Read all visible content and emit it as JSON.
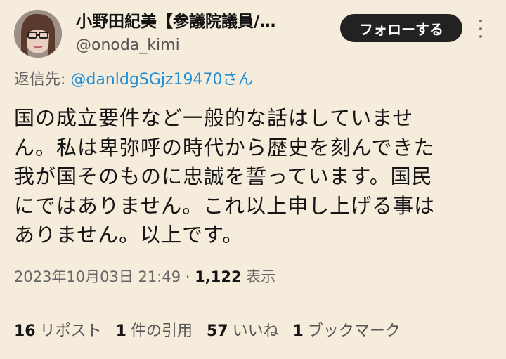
{
  "author": {
    "display_name": "小野田紀美【参議院議員/…",
    "handle": "@onoda_kimi"
  },
  "follow_button_label": "フォローする",
  "reply": {
    "prefix": "返信先: ",
    "target": "@danldgSGjz19470さん"
  },
  "tweet_text": "国の成立要件など一般的な話はしていませ\nん。私は卑弥呼の時代から歴史を刻んできた\n我が国そのものに忠誠を誓っています。国民\nにではありません。これ以上申し上げる事は\nありません。以上です。",
  "meta": {
    "timestamp": "2023年10月03日 21:49",
    "separator": " · ",
    "views_count": "1,122",
    "views_label": " 表示"
  },
  "stats": {
    "reposts": {
      "count": "16",
      "label": "リポスト"
    },
    "quotes": {
      "count": "1",
      "label": "件の引用"
    },
    "likes": {
      "count": "57",
      "label": "いいね"
    },
    "bookmarks": {
      "count": "1",
      "label": "ブックマーク"
    }
  },
  "colors": {
    "background": "#f6ecdc",
    "link": "#1d8ed6",
    "button": "#222222"
  },
  "icons": [
    "avatar",
    "more-options-icon"
  ]
}
